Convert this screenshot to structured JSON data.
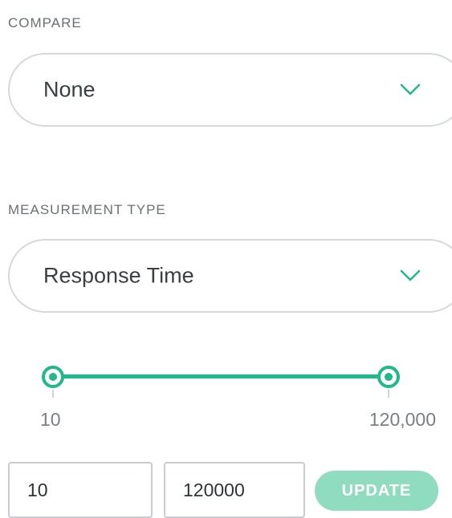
{
  "compare": {
    "label": "COMPARE",
    "selected": "None"
  },
  "measurement_type": {
    "label": "MEASUREMENT TYPE",
    "selected": "Response Time"
  },
  "range": {
    "min_label": "10",
    "max_label": "120,000",
    "min_value": "10",
    "max_value": "120000",
    "update_label": "UPDATE"
  },
  "colors": {
    "accent": "#21b88a",
    "button_disabled": "#8fdcc0",
    "border": "#d6d9dc"
  },
  "icons": {
    "dropdown": "chevron-down-icon",
    "slider_handle": "slider-handle"
  }
}
